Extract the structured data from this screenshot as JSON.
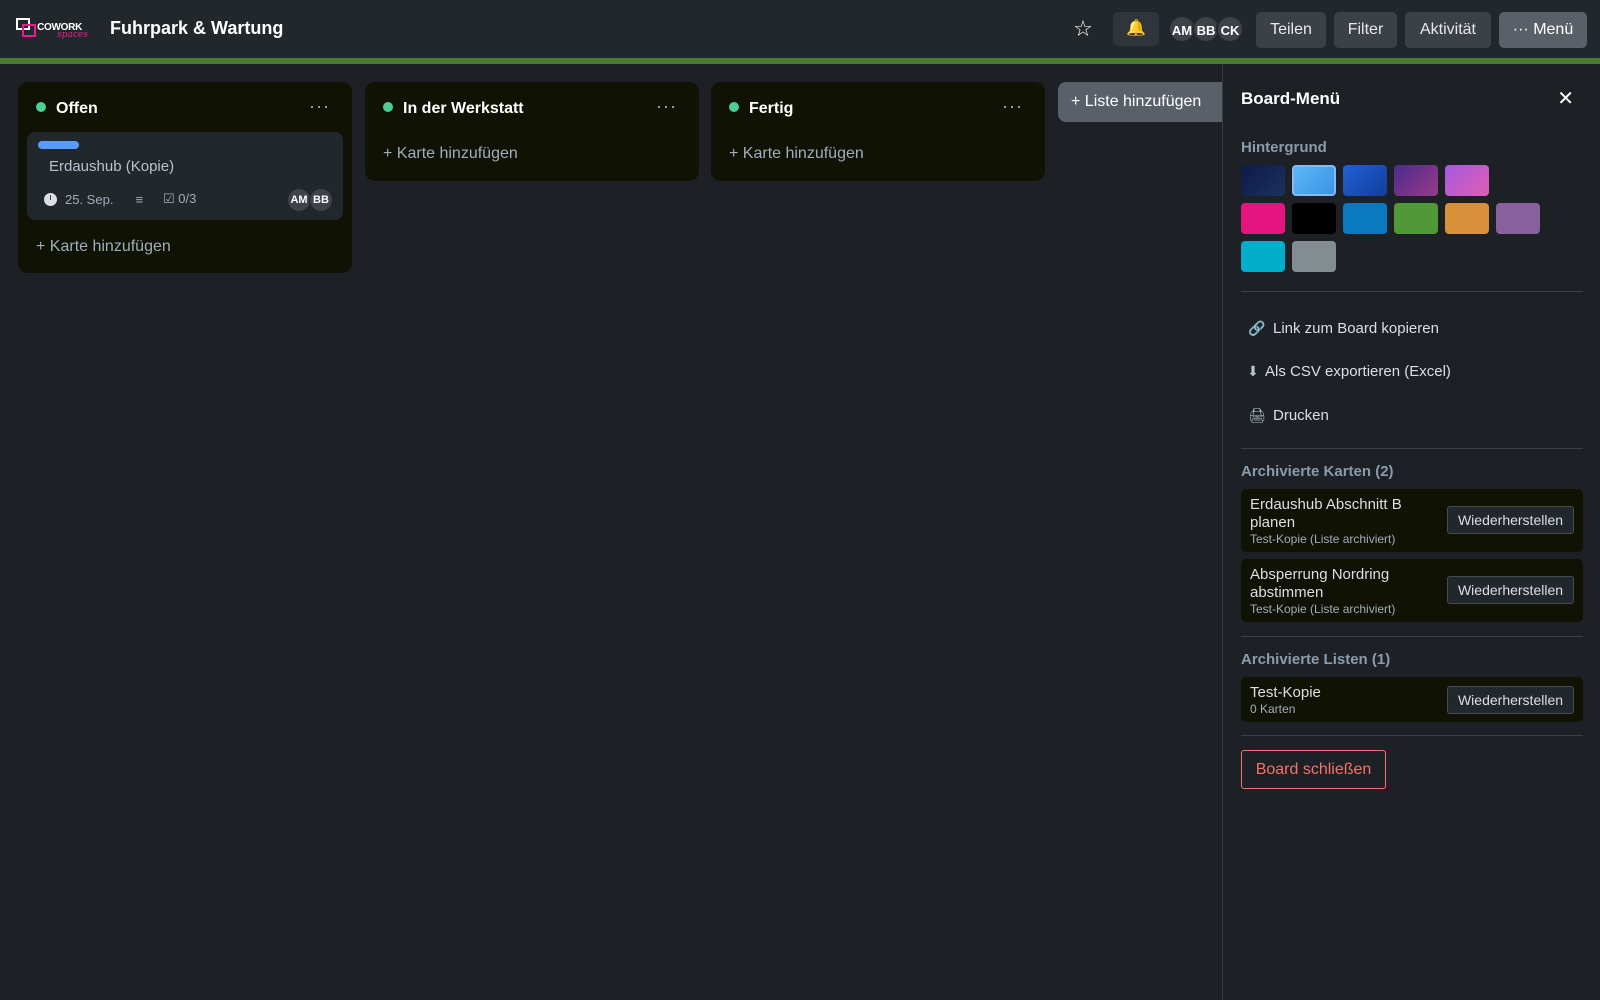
{
  "header": {
    "logo_word": "COWORK",
    "logo_sub": "spaces",
    "board_title": "Fuhrpark & Wartung",
    "star_icon": "star-outline-icon",
    "bell_icon": "bell-icon",
    "avatars": [
      "AM",
      "BB",
      "CK"
    ],
    "share_label": "Teilen",
    "filter_label": "Filter",
    "activity_label": "Aktivität",
    "menu_label": "··· Menü",
    "accent_color": "#4a7a32"
  },
  "lists": [
    {
      "title": "Offen",
      "menu": "···",
      "status_color": "#4bce97",
      "add_card_label": "+ Karte hinzufügen",
      "cards": [
        {
          "label_color": "#579dff",
          "title": "Erdaushub (Kopie)",
          "due": "25. Sep.",
          "description_icon": "≡",
          "checklist": "☑ 0/3",
          "members": [
            "AM",
            "BB"
          ]
        }
      ]
    },
    {
      "title": "In der Werkstatt",
      "menu": "···",
      "status_color": "#4bce97",
      "add_card_label": "+ Karte hinzufügen",
      "cards": []
    },
    {
      "title": "Fertig",
      "menu": "···",
      "status_color": "#4bce97",
      "add_card_label": "+ Karte hinzufügen",
      "cards": []
    }
  ],
  "add_list_label": "+ Liste hinzufügen",
  "panel": {
    "title": "Board-Menü",
    "close_icon": "✕",
    "background_heading": "Hintergrund",
    "backgrounds": [
      "#0c1a4a",
      "#4aa8ef",
      "#1e56c8",
      "#6b3a9a",
      "#c45cd8",
      "#e5157f",
      "#000000",
      "#0a79bf",
      "#519839",
      "#d9903a",
      "#89609e",
      "#00aecc",
      "#838c91"
    ],
    "actions": [
      {
        "icon": "🔗",
        "label": "Link zum Board kopieren"
      },
      {
        "icon": "⬇",
        "label": "Als CSV exportieren (Excel)"
      },
      {
        "icon": "🖨",
        "label": "Drucken"
      }
    ],
    "archived_cards_heading": "Archivierte Karten (2)",
    "archived_cards": [
      {
        "title": "Erdaushub Abschnitt B planen",
        "sub": "Test-Kopie (Liste archiviert)",
        "restore": "Wiederherstellen"
      },
      {
        "title": "Absperrung Nordring abstimmen",
        "sub": "Test-Kopie (Liste archiviert)",
        "restore": "Wiederherstellen"
      }
    ],
    "archived_lists_heading": "Archivierte Listen (1)",
    "archived_lists": [
      {
        "title": "Test-Kopie",
        "sub": "0 Karten",
        "restore": "Wiederherstellen"
      }
    ],
    "close_board_label": "Board schließen"
  }
}
